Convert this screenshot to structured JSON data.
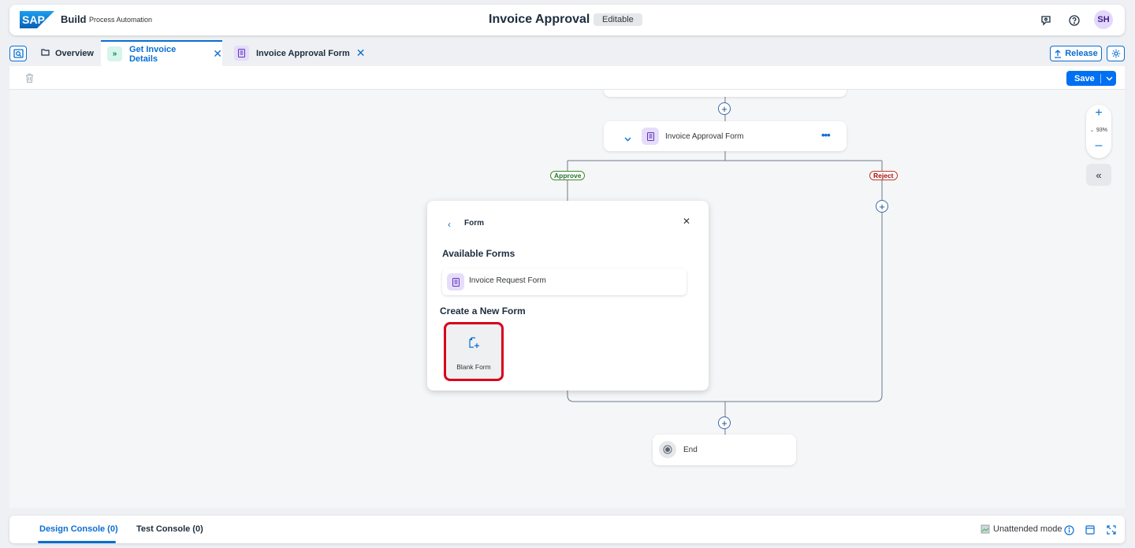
{
  "header": {
    "logo_text": "SAP",
    "brand": "Build",
    "brand_sub": "Process Automation",
    "title": "Invoice Approval",
    "status_badge": "Editable",
    "avatar_initials": "SH",
    "icons": [
      "feedback-icon",
      "help-icon"
    ]
  },
  "tabs": {
    "items": [
      {
        "label": "Overview",
        "icon": "folder-icon"
      },
      {
        "label": "Get Invoice Details",
        "icon": "process-icon",
        "active": true
      },
      {
        "label": "Invoice Approval Form",
        "icon": "form-icon"
      }
    ],
    "release_label": "Release"
  },
  "toolbar": {
    "save_label": "Save"
  },
  "canvas": {
    "form_node_label": "Invoice Approval Form",
    "approve_label": "Approve",
    "reject_label": "Reject",
    "end_label": "End",
    "zoom_level": "93%"
  },
  "popover": {
    "title": "Form",
    "available_heading": "Available Forms",
    "available_forms": [
      "Invoice Request Form"
    ],
    "create_heading": "Create a New Form",
    "blank_form_label": "Blank Form"
  },
  "footer": {
    "design_console": "Design Console (0)",
    "test_console": "Test Console (0)",
    "mode_label": "Unattended mode"
  },
  "colors": {
    "accent": "#0a6ed1",
    "save_button": "#0070f2",
    "highlight": "#d9001b",
    "approve": "#256f3a",
    "reject": "#aa0808",
    "form_icon_bg": "#e6dcfb"
  }
}
